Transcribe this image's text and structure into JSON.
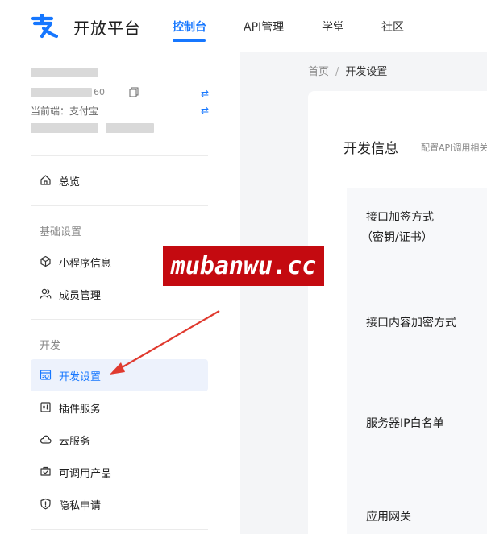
{
  "brand": {
    "name": "开放平台",
    "logo_icon": "alipay-logo-icon",
    "color": "#1677ff"
  },
  "nav": {
    "tabs": [
      {
        "label": "控制台",
        "active": true
      },
      {
        "label": "API管理",
        "active": false
      },
      {
        "label": "学堂",
        "active": false
      },
      {
        "label": "社区",
        "active": false
      }
    ]
  },
  "account": {
    "id_suffix": "60",
    "client_label": "当前端：支付宝",
    "icons": [
      "copy-icon",
      "swap-icon"
    ]
  },
  "sidebar": {
    "overview": {
      "label": "总览",
      "icon": "home-icon"
    },
    "sections": [
      {
        "title": "基础设置",
        "items": [
          {
            "label": "小程序信息",
            "icon": "cube-icon",
            "active": false
          },
          {
            "label": "成员管理",
            "icon": "users-icon",
            "active": false
          }
        ]
      },
      {
        "title": "开发",
        "items": [
          {
            "label": "开发设置",
            "icon": "dev-settings-icon",
            "active": true
          },
          {
            "label": "插件服务",
            "icon": "plugin-icon",
            "active": false
          },
          {
            "label": "云服务",
            "icon": "cloud-icon",
            "active": false
          },
          {
            "label": "可调用产品",
            "icon": "product-icon",
            "active": false
          },
          {
            "label": "隐私申请",
            "icon": "shield-icon",
            "active": false
          }
        ]
      }
    ]
  },
  "breadcrumb": {
    "home": "首页",
    "separator": "/",
    "current": "开发设置"
  },
  "card": {
    "title": "开发信息",
    "subtitle": "配置API调用相关"
  },
  "fields": [
    {
      "label_line1": "接口加签方式",
      "label_line2": "（密钥/证书）"
    },
    {
      "label_line1": "接口内容加密方式",
      "label_line2": ""
    },
    {
      "label_line1": "服务器IP白名单",
      "label_line2": ""
    },
    {
      "label_line1": "应用网关",
      "label_line2": ""
    }
  ],
  "watermark": {
    "text": "mubanwu.cc",
    "color": "#c40a10"
  },
  "accent_colors": {
    "primary": "#1677ff",
    "active_bg": "#edf2fc",
    "annotation_red": "#e03a2f"
  }
}
